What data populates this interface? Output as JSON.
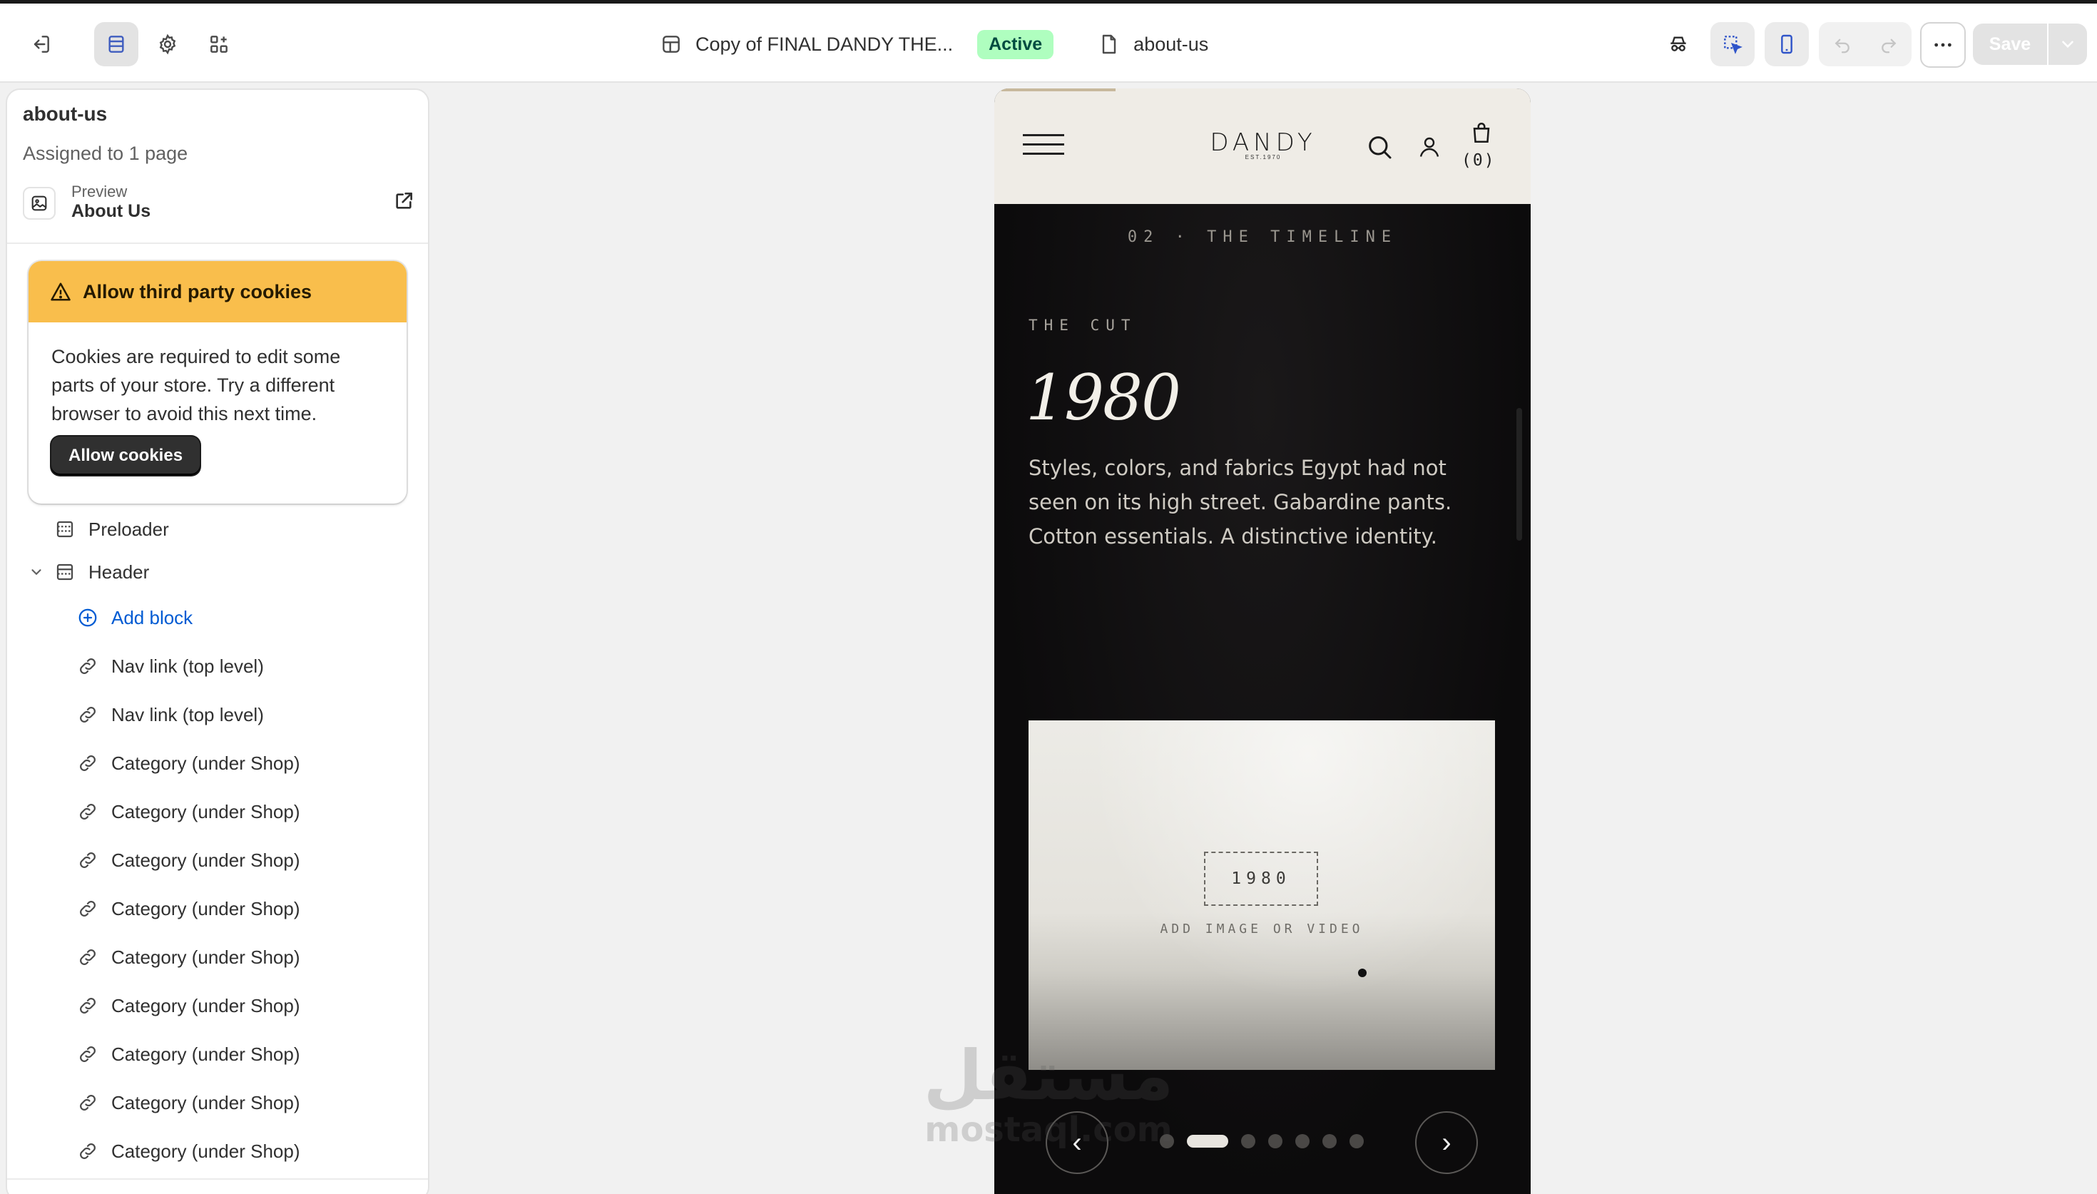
{
  "topbar": {
    "theme_name": "Copy of FINAL DANDY THE...",
    "status": "Active",
    "page": "about-us",
    "save_label": "Save"
  },
  "sidebar": {
    "title": "about-us",
    "assigned": "Assigned to 1 page",
    "preview_label": "Preview",
    "preview_page": "About Us",
    "cookie": {
      "title": "Allow third party cookies",
      "body": "Cookies are required to edit some parts of your store. Try a different browser to avoid this next time.",
      "button": "Allow cookies"
    },
    "tree": [
      {
        "label": "Preloader",
        "icon": "section-icon"
      },
      {
        "label": "Header",
        "icon": "section-icon"
      },
      {
        "label": "Add block",
        "icon": "plus-circle-icon"
      },
      {
        "label": "Nav link (top level)",
        "icon": "link-icon"
      },
      {
        "label": "Nav link (top level)",
        "icon": "link-icon"
      },
      {
        "label": "Category (under Shop)",
        "icon": "link-icon"
      },
      {
        "label": "Category (under Shop)",
        "icon": "link-icon"
      },
      {
        "label": "Category (under Shop)",
        "icon": "link-icon"
      },
      {
        "label": "Category (under Shop)",
        "icon": "link-icon"
      },
      {
        "label": "Category (under Shop)",
        "icon": "link-icon"
      },
      {
        "label": "Category (under Shop)",
        "icon": "link-icon"
      },
      {
        "label": "Category (under Shop)",
        "icon": "link-icon"
      },
      {
        "label": "Category (under Shop)",
        "icon": "link-icon"
      },
      {
        "label": "Category (under Shop)",
        "icon": "link-icon"
      }
    ]
  },
  "preview": {
    "logo": "DANDY",
    "logo_sub": "EST.1970",
    "cart_count": "(0)",
    "eyebrow": "02 · THE TIMELINE",
    "label": "THE CUT",
    "year": "1980",
    "description": "Styles, colors, and fabrics Egypt had not seen on its high street. Gabardine pants. Cotton essentials. A distinctive identity.",
    "media_year": "1980",
    "media_hint": "ADD IMAGE OR VIDEO",
    "prev": "‹",
    "next": "›",
    "slide_count": 7,
    "active_slide": 2
  },
  "watermark": {
    "arabic": "مستقل",
    "latin": "mostaql.com"
  },
  "colors": {
    "cookie_banner": "#f9be4c",
    "active_badge": "#affebf",
    "link_blue": "#005bd3",
    "preview_bg": "#0c0b0c",
    "preview_header": "#efece6"
  }
}
